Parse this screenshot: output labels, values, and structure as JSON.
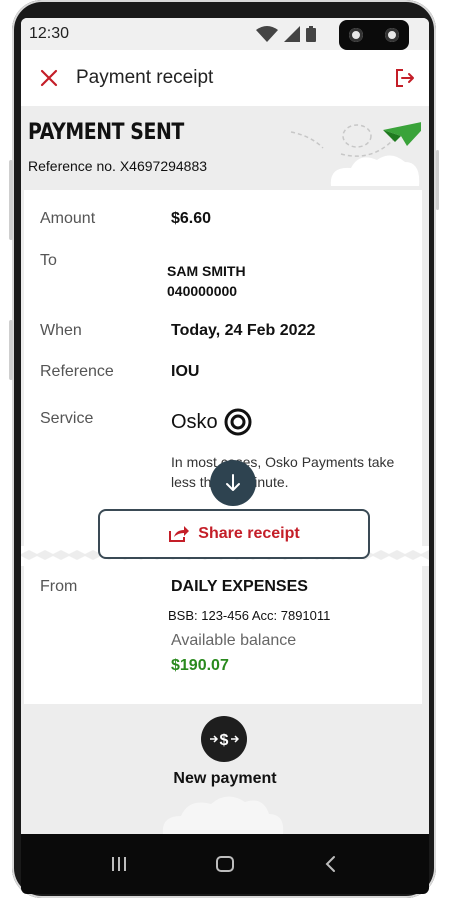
{
  "status_bar": {
    "time": "12:30",
    "icons": [
      "wifi-icon",
      "cellular-icon",
      "battery-icon"
    ]
  },
  "app_bar": {
    "title": "Payment receipt",
    "close_icon": "close-icon",
    "exit_icon": "exit-icon"
  },
  "banner": {
    "heading": "PAYMENT SENT",
    "reference_no": "Reference no. X4697294883"
  },
  "details": {
    "amount": {
      "label": "Amount",
      "value": "$6.60"
    },
    "to": {
      "label": "To",
      "name": "SAM SMITH",
      "account": "040000000"
    },
    "when": {
      "label": "When",
      "value": "Today, 24 Feb 2022"
    },
    "reference": {
      "label": "Reference",
      "value": "IOU"
    },
    "service": {
      "label": "Service",
      "brand": "Osko",
      "note": "In most cases, Osko Payments take less than a minute."
    }
  },
  "share": {
    "label": "Share receipt",
    "icon": "share-icon"
  },
  "from": {
    "label": "From",
    "account_name": "DAILY EXPENSES",
    "bsb_acc": "BSB: 123-456 Acc: 7891011",
    "available_label": "Available balance",
    "available_balance": "$190.07"
  },
  "new_payment": {
    "label": "New payment",
    "icon": "transfer-money-icon"
  },
  "colors": {
    "brand_red": "#c41e28",
    "positive_green": "#2a8a1e",
    "dark_fab": "#2e4350"
  }
}
